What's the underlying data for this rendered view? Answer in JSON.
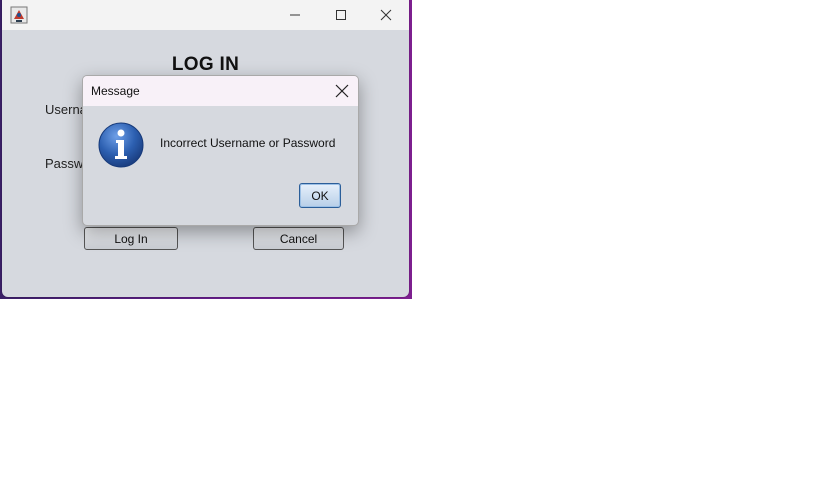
{
  "window": {
    "title": "",
    "controls": {
      "minimize": "minimize-icon",
      "maximize": "maximize-icon",
      "close": "close-icon"
    }
  },
  "form": {
    "heading": "LOG IN",
    "username_label": "Userna",
    "password_label": "Passw",
    "login_button": "Log In",
    "cancel_button": "Cancel"
  },
  "dialog": {
    "title": "Message",
    "message": "Incorrect Username or Password",
    "ok_button": "OK",
    "icon": "info-icon"
  },
  "colors": {
    "window_bg": "#d6d9df",
    "titlebar_bg": "#f3f3f3",
    "desktop_accent": "#6a1e8c",
    "info_icon_blue": "#2c5fb0",
    "ok_border": "#2b5e99"
  }
}
